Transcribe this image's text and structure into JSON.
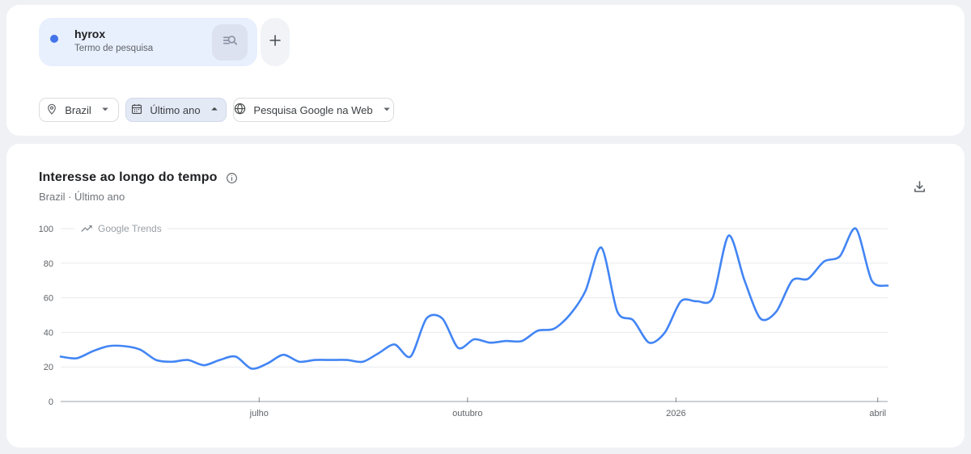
{
  "page": {
    "background": "#eff1f5"
  },
  "search_card": {
    "term": {
      "label": "hyrox",
      "sublabel": "Termo de pesquisa",
      "dot_color": "#4374e9"
    },
    "search_button_icon": "manage-search-icon",
    "add_button_icon": "plus-icon"
  },
  "filters": [
    {
      "label": "Brazil",
      "icon": "location-pin-icon",
      "caret": "down",
      "active": false
    },
    {
      "label": "Último ano",
      "icon": "calendar-icon",
      "caret": "up",
      "active": true
    },
    {
      "label": "Pesquisa Google na Web",
      "icon": "globe-icon",
      "caret": "down",
      "active": false
    }
  ],
  "chart_card": {
    "title": "Interesse ao longo do tempo",
    "subtitle": "Brazil · Último ano",
    "watermark": "Google Trends",
    "download_icon": "download-icon",
    "info_icon": "info-icon"
  },
  "chart_data": {
    "type": "line",
    "title": "Interesse ao longo do tempo",
    "x_unit": "week",
    "series": [
      {
        "name": "hyrox",
        "color": "#4285f4",
        "values": [
          26,
          25,
          29,
          32,
          32,
          30,
          24,
          23,
          24,
          21,
          24,
          26,
          19,
          22,
          27,
          23,
          24,
          24,
          24,
          23,
          28,
          33,
          26,
          48,
          48,
          31,
          36,
          34,
          35,
          35,
          41,
          42,
          50,
          64,
          89,
          52,
          47,
          34,
          40,
          58,
          58,
          60,
          96,
          70,
          48,
          52,
          70,
          71,
          81,
          84,
          100,
          70,
          67
        ]
      }
    ],
    "xticks": [
      {
        "label": "julho",
        "pos": 0.24
      },
      {
        "label": "outubro",
        "pos": 0.492
      },
      {
        "label": "2026",
        "pos": 0.744
      },
      {
        "label": "abril",
        "pos": 0.988
      }
    ],
    "yticks": [
      0,
      20,
      40,
      60,
      80,
      100
    ],
    "ylim": [
      0,
      100
    ],
    "grid": "horizontal",
    "grid_color": "#e8eaed",
    "axis_color": "#9aa0a6"
  }
}
